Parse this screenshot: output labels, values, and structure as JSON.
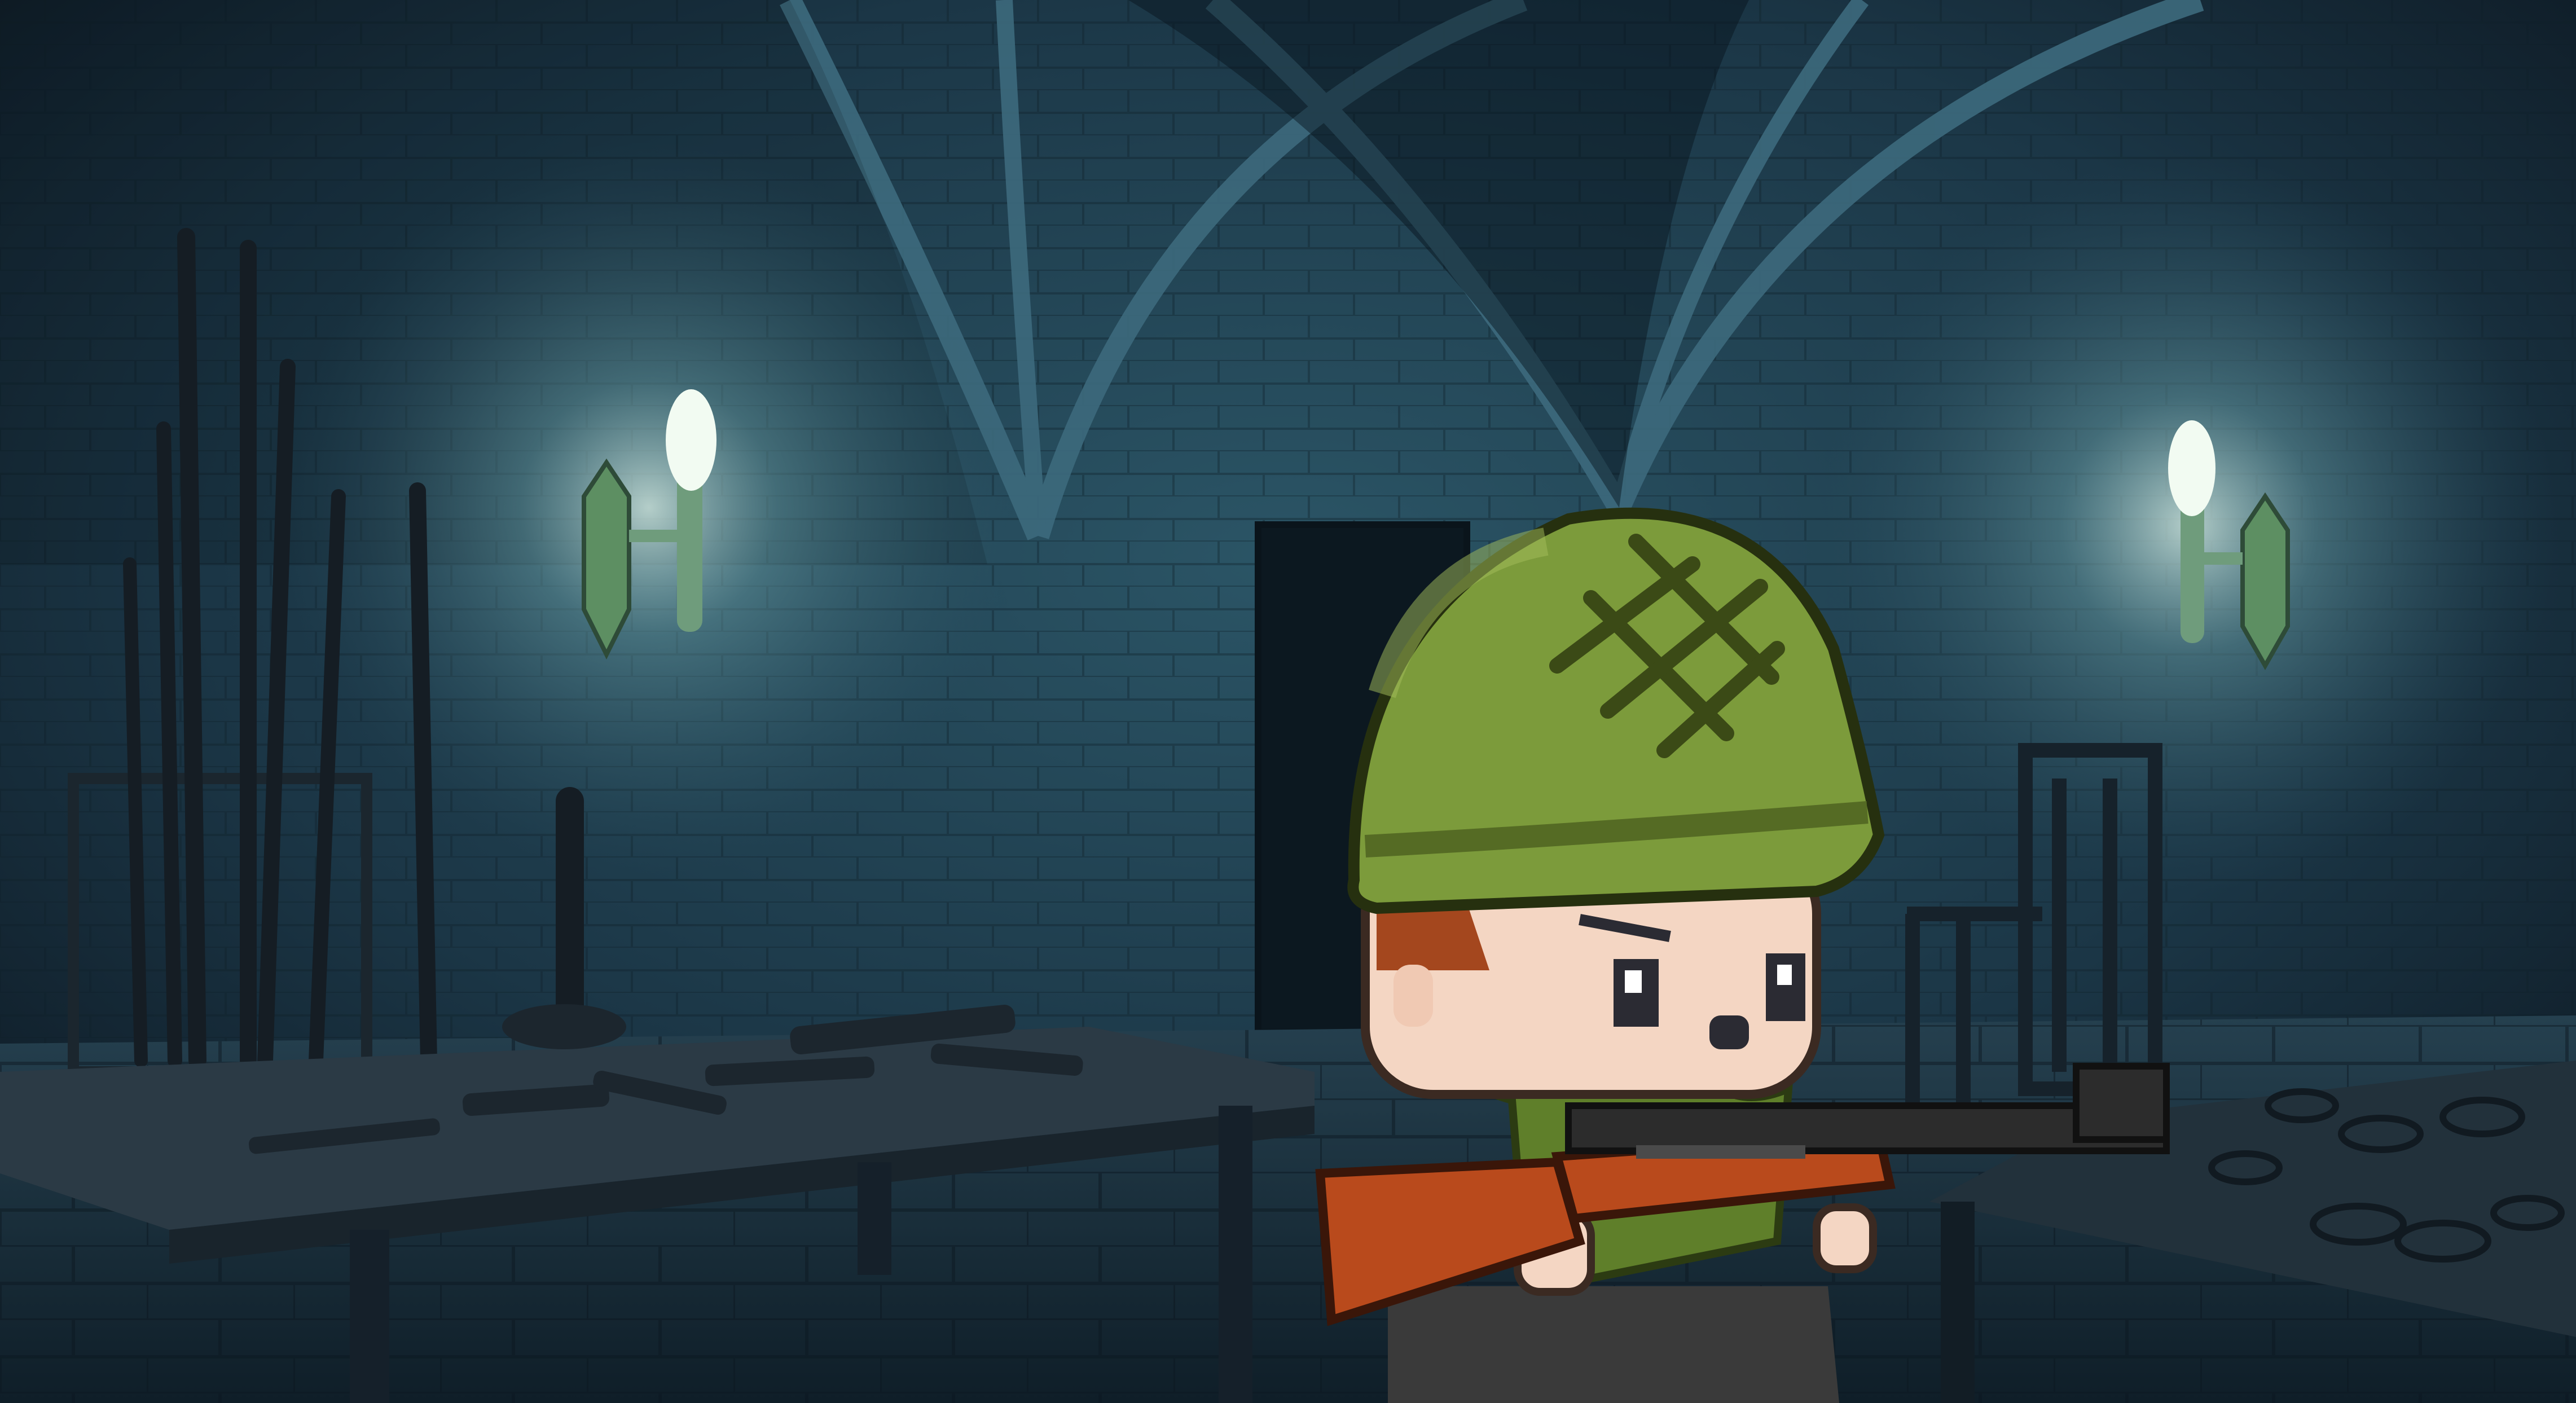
{
  "scene": {
    "setting": "dungeon armory",
    "elements": [
      "vaulted-ceiling",
      "stone-brick-wall",
      "wall-torch-left",
      "wall-torch-right",
      "weapon-rack",
      "weapon-table",
      "doorway",
      "torture-chair",
      "shackles-table",
      "soldier-character"
    ]
  },
  "palette": {
    "wall": "#2f5868",
    "wall_dark": "#14242f",
    "floor": "#1f3644",
    "torch_glow": "#cfe8e0",
    "helmet": "#7c9b3b",
    "helmet_dark": "#556b24",
    "skin": "#f4d6c3",
    "hair": "#a4471e",
    "scarf": "#5f7f2a",
    "rifle_wood": "#b94a1c",
    "rifle_metal": "#2c2c2c",
    "pants": "#3a3a3a"
  }
}
